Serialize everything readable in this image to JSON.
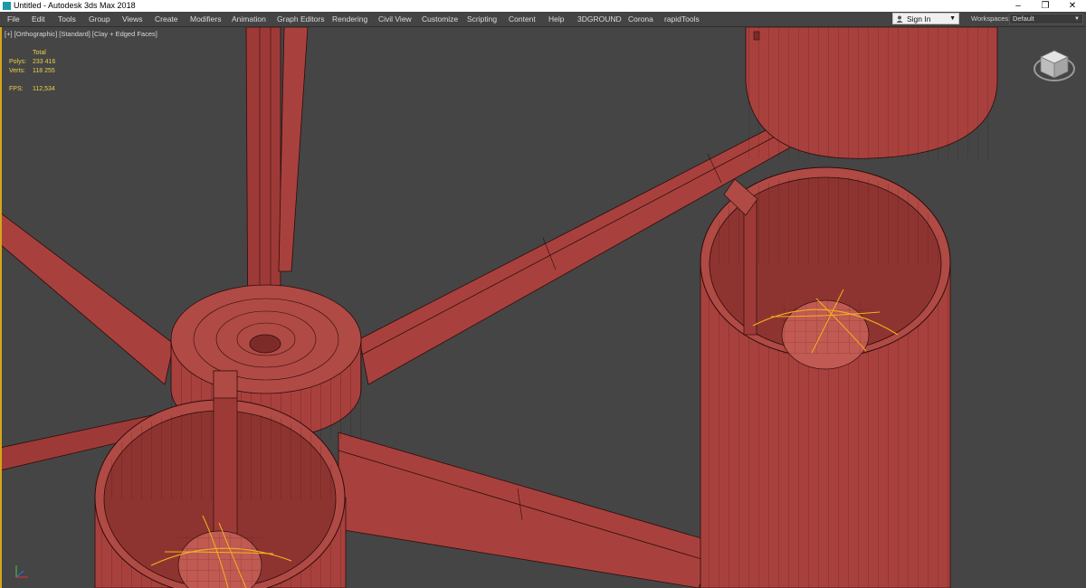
{
  "window": {
    "title": "Untitled - Autodesk 3ds Max 2018",
    "controls": {
      "minimize": "–",
      "restore": "❐",
      "close": "✕"
    }
  },
  "menu": {
    "items": [
      "File",
      "Edit",
      "Tools",
      "Group",
      "Views",
      "Create",
      "Modifiers",
      "Animation",
      "Graph Editors",
      "Rendering",
      "Civil View",
      "Customize",
      "Scripting",
      "Content",
      "Help",
      "3DGROUND",
      "Corona",
      "rapidTools"
    ],
    "sign_in": "Sign In",
    "workspaces_label": "Workspaces:",
    "workspaces_value": "Default"
  },
  "viewport": {
    "label": "[+] [Orthographic] [Standard] [Clay + Edged Faces]",
    "stats": {
      "header": "Total",
      "polys_label": "Polys:",
      "polys_value": "233 416",
      "verts_label": "Verts:",
      "verts_value": "118 255",
      "fps_label": "FPS:",
      "fps_value": "112,534"
    }
  },
  "colors": {
    "accent": "#d2a71b",
    "viewport_bg": "#454545",
    "clay": "#a8413d",
    "clay_dark": "#7d2b28",
    "wire": "#2e0c0b",
    "highlight": "#f2b21c"
  },
  "icons": [
    "app-icon",
    "user-icon",
    "chevron-down-icon",
    "viewcube-icon",
    "axis-tripod-icon"
  ]
}
